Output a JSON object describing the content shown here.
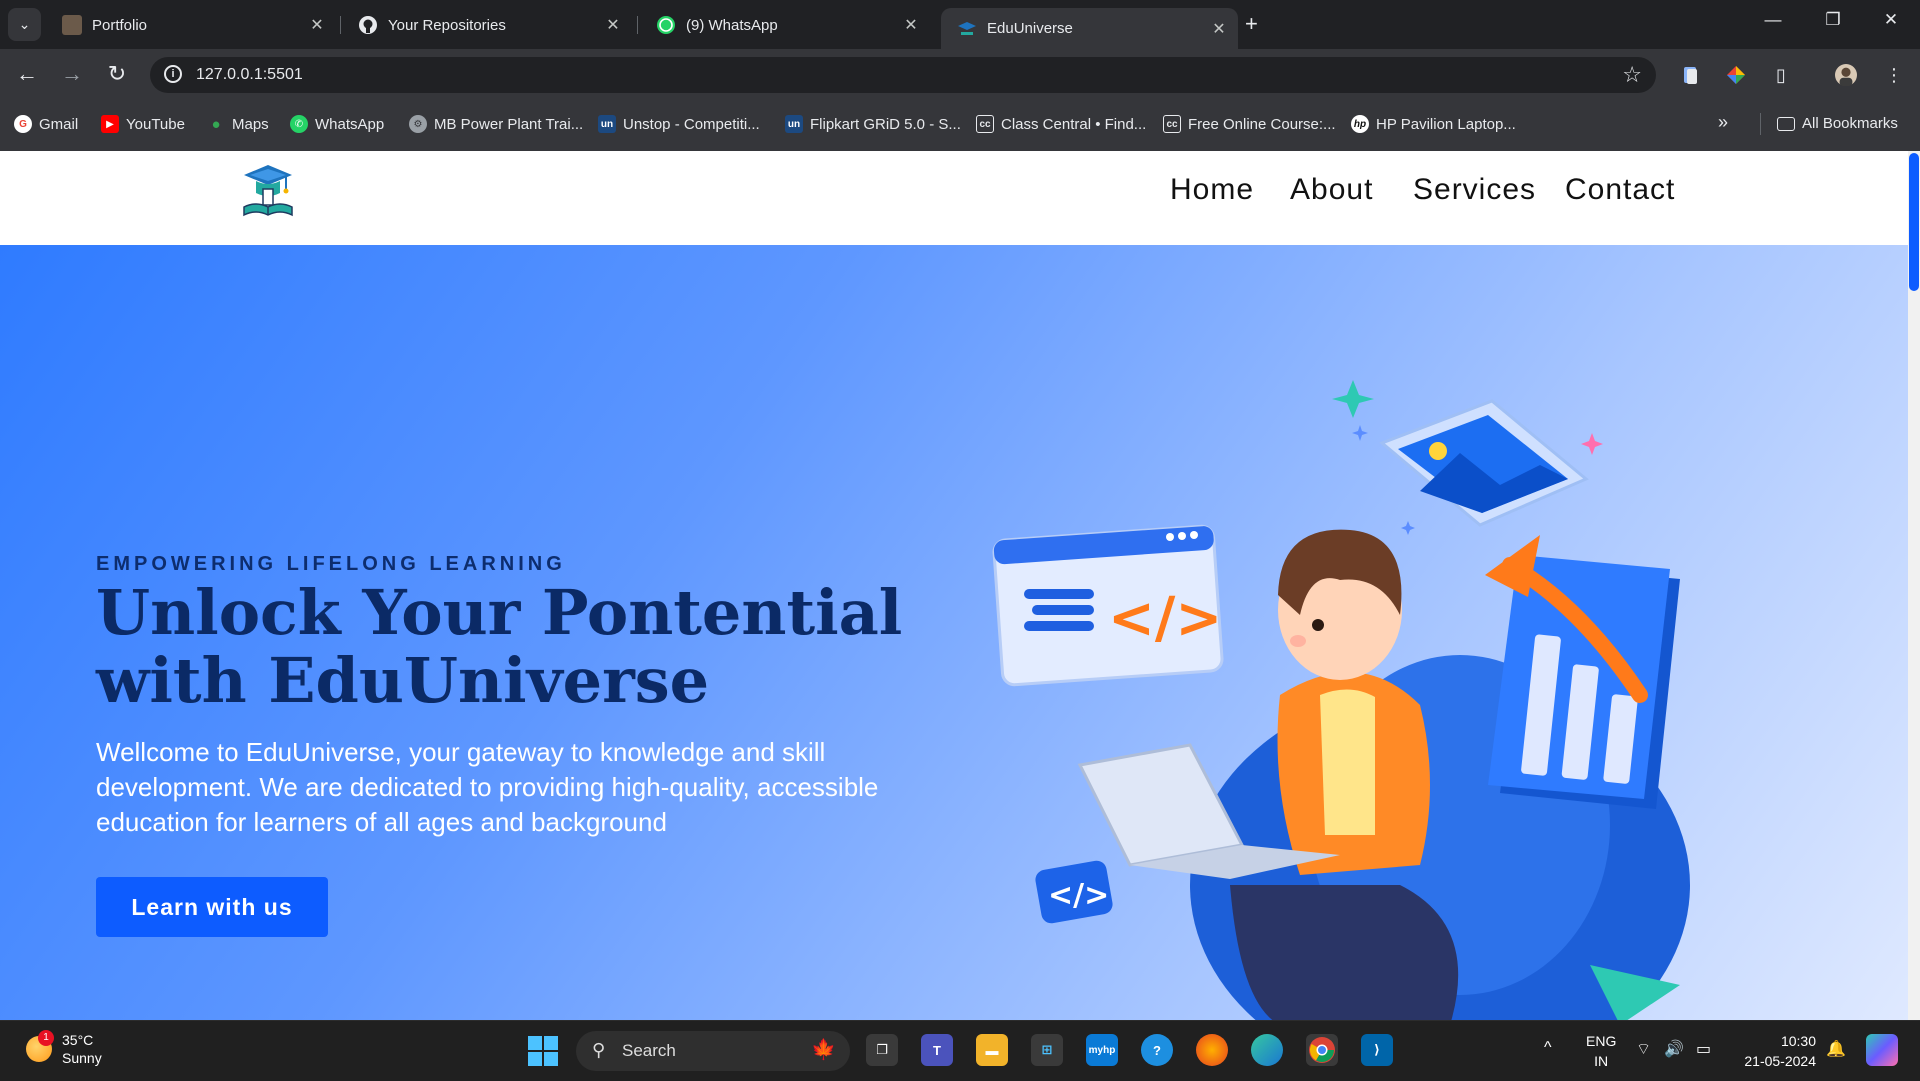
{
  "browser": {
    "tabs": [
      {
        "title": "Portfolio",
        "icon": "portfolio-favicon"
      },
      {
        "title": "Your Repositories",
        "icon": "github-icon"
      },
      {
        "title": "(9) WhatsApp",
        "icon": "whatsapp-icon"
      },
      {
        "title": "EduUniverse",
        "icon": "eduuniverse-favicon",
        "active": true
      }
    ],
    "url": "127.0.0.1:5501",
    "bookmarks": [
      {
        "label": "Gmail",
        "icon": "gmail-icon"
      },
      {
        "label": "YouTube",
        "icon": "youtube-icon"
      },
      {
        "label": "Maps",
        "icon": "maps-icon"
      },
      {
        "label": "WhatsApp",
        "icon": "whatsapp-icon"
      },
      {
        "label": "MB Power Plant Trai...",
        "icon": "power-plant-icon"
      },
      {
        "label": "Unstop - Competiti...",
        "icon": "unstop-icon"
      },
      {
        "label": "Flipkart GRiD 5.0 - S...",
        "icon": "unstop-icon"
      },
      {
        "label": "Class Central • Find...",
        "icon": "class-central-icon"
      },
      {
        "label": "Free Online Course:...",
        "icon": "class-central-icon"
      },
      {
        "label": "HP Pavilion Laptop...",
        "icon": "hp-icon"
      }
    ],
    "all_bookmarks_label": "All Bookmarks"
  },
  "site": {
    "nav": [
      "Home",
      "About",
      "Services",
      "Contact"
    ],
    "hero": {
      "eyebrow": "EMPOWERING LIFELONG LEARNING",
      "headline": "Unlock Your Pontential with EduUniverse",
      "description": "Wellcome to EduUniverse, your gateway to knowledge and skill development. We are dedicated to providing high-quality, accessible education for learners of all ages and background",
      "cta": "Learn with us"
    },
    "colors": {
      "accent": "#0d5cff",
      "headline": "#0b2a66",
      "hero_gradient_start": "#2f7bff",
      "hero_gradient_end": "#dfe9ff"
    }
  },
  "taskbar": {
    "weather": {
      "temp": "35°C",
      "condition": "Sunny",
      "badge": "1"
    },
    "search_label": "Search",
    "language": {
      "line1": "ENG",
      "line2": "IN"
    },
    "time": "10:30",
    "date": "21-05-2024"
  }
}
